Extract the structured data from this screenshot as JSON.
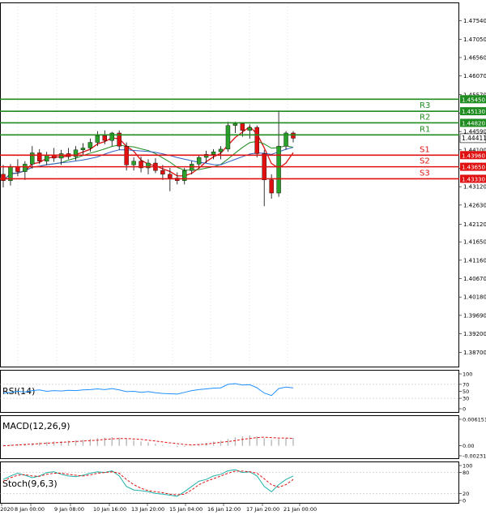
{
  "chart_data": {
    "type": "candlestick",
    "price_axis": {
      "ticks": [
        "1.47540",
        "1.47050",
        "1.46560",
        "1.46070",
        "1.45570",
        "1.45080",
        "1.44590",
        "1.44100",
        "1.43610",
        "1.43120",
        "1.42630",
        "1.42120",
        "1.41650",
        "1.41160",
        "1.40670",
        "1.40180",
        "1.39690",
        "1.39200",
        "1.38700"
      ],
      "ylim": [
        1.3851,
        1.4778
      ]
    },
    "time_axis": {
      "labels": [
        "8 Jan 2020",
        "8 Jan 00:00",
        "9 Jan 08:00",
        "10 Jan 16:00",
        "13 Jan 20:00",
        "15 Jan 04:00",
        "16 Jan 12:00",
        "17 Jan 20:00",
        "21 Jan 00:00"
      ],
      "label_display": [
        "8 Jan 2020",
        "8 Jan 00:00",
        "9 Jan 08:00",
        "10 Jan 16:00",
        "13 Jan 20:00",
        "15 Jan 04:00",
        "16 Jan 12:00",
        "17 Jan 20:00",
        "21 Jan 00:00"
      ]
    },
    "current_price": "1.44411",
    "levels": [
      {
        "name": "R3",
        "value": 1.4513,
        "label": "1.45130",
        "color": "#1e8c1e"
      },
      {
        "name": "R2",
        "value": 1.4482,
        "label": "1.44820",
        "color": "#1e8c1e"
      },
      {
        "name": "R1",
        "value": 1.445,
        "label": "",
        "color": "#1e8c1e"
      },
      {
        "name": "",
        "value": 1.4545,
        "label": "1.45450",
        "color": "#1e8c1e"
      },
      {
        "name": "S1",
        "value": 1.4396,
        "label": "1.43960",
        "color": "#e01010"
      },
      {
        "name": "S2",
        "value": 1.4365,
        "label": "1.43650",
        "color": "#e01010"
      },
      {
        "name": "S3",
        "value": 1.4333,
        "label": "1.43330",
        "color": "#e01010"
      }
    ],
    "level_names": [
      "R3",
      "R2",
      "R1",
      "S1",
      "S2",
      "S3"
    ],
    "candles": [
      {
        "o": 1.4345,
        "h": 1.437,
        "l": 1.431,
        "c": 1.4328
      },
      {
        "o": 1.4328,
        "h": 1.4372,
        "l": 1.4315,
        "c": 1.4365
      },
      {
        "o": 1.4365,
        "h": 1.4385,
        "l": 1.434,
        "c": 1.4352
      },
      {
        "o": 1.4352,
        "h": 1.438,
        "l": 1.433,
        "c": 1.4372
      },
      {
        "o": 1.4372,
        "h": 1.442,
        "l": 1.436,
        "c": 1.4402
      },
      {
        "o": 1.4402,
        "h": 1.4412,
        "l": 1.4372,
        "c": 1.438
      },
      {
        "o": 1.438,
        "h": 1.4405,
        "l": 1.437,
        "c": 1.4395
      },
      {
        "o": 1.4395,
        "h": 1.4415,
        "l": 1.4378,
        "c": 1.4388
      },
      {
        "o": 1.4388,
        "h": 1.441,
        "l": 1.437,
        "c": 1.44
      },
      {
        "o": 1.44,
        "h": 1.4415,
        "l": 1.4385,
        "c": 1.4392
      },
      {
        "o": 1.4392,
        "h": 1.442,
        "l": 1.4382,
        "c": 1.441
      },
      {
        "o": 1.441,
        "h": 1.4428,
        "l": 1.4398,
        "c": 1.4415
      },
      {
        "o": 1.4415,
        "h": 1.444,
        "l": 1.4405,
        "c": 1.443
      },
      {
        "o": 1.443,
        "h": 1.446,
        "l": 1.442,
        "c": 1.4448
      },
      {
        "o": 1.4448,
        "h": 1.4462,
        "l": 1.4425,
        "c": 1.4435
      },
      {
        "o": 1.4435,
        "h": 1.4458,
        "l": 1.442,
        "c": 1.4455
      },
      {
        "o": 1.4455,
        "h": 1.4462,
        "l": 1.441,
        "c": 1.442
      },
      {
        "o": 1.442,
        "h": 1.443,
        "l": 1.4355,
        "c": 1.437
      },
      {
        "o": 1.437,
        "h": 1.439,
        "l": 1.4355,
        "c": 1.438
      },
      {
        "o": 1.438,
        "h": 1.4392,
        "l": 1.435,
        "c": 1.4362
      },
      {
        "o": 1.4362,
        "h": 1.4385,
        "l": 1.4345,
        "c": 1.4375
      },
      {
        "o": 1.4375,
        "h": 1.4388,
        "l": 1.4348,
        "c": 1.4355
      },
      {
        "o": 1.4355,
        "h": 1.437,
        "l": 1.433,
        "c": 1.4345
      },
      {
        "o": 1.4345,
        "h": 1.4362,
        "l": 1.43,
        "c": 1.4335
      },
      {
        "o": 1.4335,
        "h": 1.435,
        "l": 1.4318,
        "c": 1.4328
      },
      {
        "o": 1.4328,
        "h": 1.4362,
        "l": 1.4318,
        "c": 1.4355
      },
      {
        "o": 1.4355,
        "h": 1.438,
        "l": 1.4345,
        "c": 1.4372
      },
      {
        "o": 1.4372,
        "h": 1.4395,
        "l": 1.436,
        "c": 1.439
      },
      {
        "o": 1.439,
        "h": 1.4408,
        "l": 1.4375,
        "c": 1.4398
      },
      {
        "o": 1.4398,
        "h": 1.4412,
        "l": 1.4385,
        "c": 1.4405
      },
      {
        "o": 1.4405,
        "h": 1.442,
        "l": 1.4385,
        "c": 1.4412
      },
      {
        "o": 1.4412,
        "h": 1.4485,
        "l": 1.4405,
        "c": 1.4475
      },
      {
        "o": 1.4475,
        "h": 1.4485,
        "l": 1.4455,
        "c": 1.448
      },
      {
        "o": 1.448,
        "h": 1.4482,
        "l": 1.4445,
        "c": 1.4462
      },
      {
        "o": 1.4462,
        "h": 1.4478,
        "l": 1.444,
        "c": 1.447
      },
      {
        "o": 1.447,
        "h": 1.4475,
        "l": 1.439,
        "c": 1.44
      },
      {
        "o": 1.44,
        "h": 1.441,
        "l": 1.426,
        "c": 1.433
      },
      {
        "o": 1.433,
        "h": 1.4345,
        "l": 1.428,
        "c": 1.4295
      },
      {
        "o": 1.4295,
        "h": 1.4515,
        "l": 1.4285,
        "c": 1.442
      },
      {
        "o": 1.442,
        "h": 1.446,
        "l": 1.441,
        "c": 1.4455
      },
      {
        "o": 1.4455,
        "h": 1.446,
        "l": 1.443,
        "c": 1.4441
      }
    ],
    "indicators": [
      {
        "name": "RSI(14)",
        "ticks": [
          "100",
          "70",
          "50",
          "30",
          "0"
        ],
        "range": [
          0,
          100
        ]
      },
      {
        "name": "MACD(12,26,9)",
        "ticks": [
          "0.006151",
          "0.00",
          "-0.002318"
        ],
        "range": [
          -0.002318,
          0.006151
        ]
      },
      {
        "name": "Stoch(9,6,3)",
        "ticks": [
          "100",
          "80",
          "20",
          "0"
        ],
        "range": [
          0,
          100
        ]
      }
    ],
    "rsi": [
      45,
      47,
      50,
      48,
      52,
      54,
      50,
      52,
      51,
      53,
      52,
      54,
      55,
      57,
      55,
      58,
      54,
      49,
      50,
      47,
      49,
      46,
      44,
      43,
      42,
      47,
      52,
      55,
      57,
      59,
      60,
      70,
      72,
      68,
      69,
      60,
      45,
      38,
      58,
      62,
      60
    ],
    "macd_hist": [
      0.0002,
      0.0003,
      0.0004,
      0.0005,
      0.0006,
      0.0008,
      0.0009,
      0.001,
      0.0011,
      0.0012,
      0.0013,
      0.0014,
      0.0016,
      0.0018,
      0.0019,
      0.002,
      0.0019,
      0.0016,
      0.0013,
      0.001,
      0.0008,
      0.0005,
      0.0002,
      -0.0001,
      -0.0003,
      -0.0002,
      0.0001,
      0.0004,
      0.0007,
      0.001,
      0.0012,
      0.0016,
      0.002,
      0.0022,
      0.0024,
      0.0022,
      0.0018,
      0.0014,
      0.0016,
      0.0018,
      0.0019
    ],
    "macd_signal": [
      0.0,
      0.0001,
      0.0002,
      0.0003,
      0.0004,
      0.0005,
      0.0006,
      0.0007,
      0.0008,
      0.0009,
      0.001,
      0.0011,
      0.0012,
      0.0013,
      0.0015,
      0.0016,
      0.0017,
      0.0017,
      0.0016,
      0.0015,
      0.0013,
      0.0011,
      0.0009,
      0.0007,
      0.0005,
      0.0003,
      0.0002,
      0.0003,
      0.0004,
      0.0006,
      0.0008,
      0.001,
      0.0012,
      0.0015,
      0.0017,
      0.0019,
      0.002,
      0.0019,
      0.0018,
      0.0018,
      0.0017
    ],
    "stoch_k": [
      60,
      70,
      78,
      72,
      65,
      70,
      80,
      82,
      75,
      70,
      68,
      72,
      78,
      82,
      80,
      85,
      70,
      40,
      30,
      28,
      25,
      20,
      18,
      15,
      12,
      25,
      40,
      55,
      60,
      70,
      75,
      85,
      88,
      80,
      82,
      70,
      40,
      25,
      45,
      60,
      70
    ],
    "stoch_d": [
      55,
      65,
      72,
      74,
      70,
      69,
      75,
      78,
      78,
      75,
      72,
      70,
      73,
      78,
      80,
      82,
      78,
      60,
      45,
      35,
      28,
      25,
      22,
      18,
      16,
      18,
      30,
      45,
      55,
      62,
      70,
      78,
      84,
      84,
      82,
      78,
      62,
      45,
      38,
      45,
      60
    ]
  }
}
